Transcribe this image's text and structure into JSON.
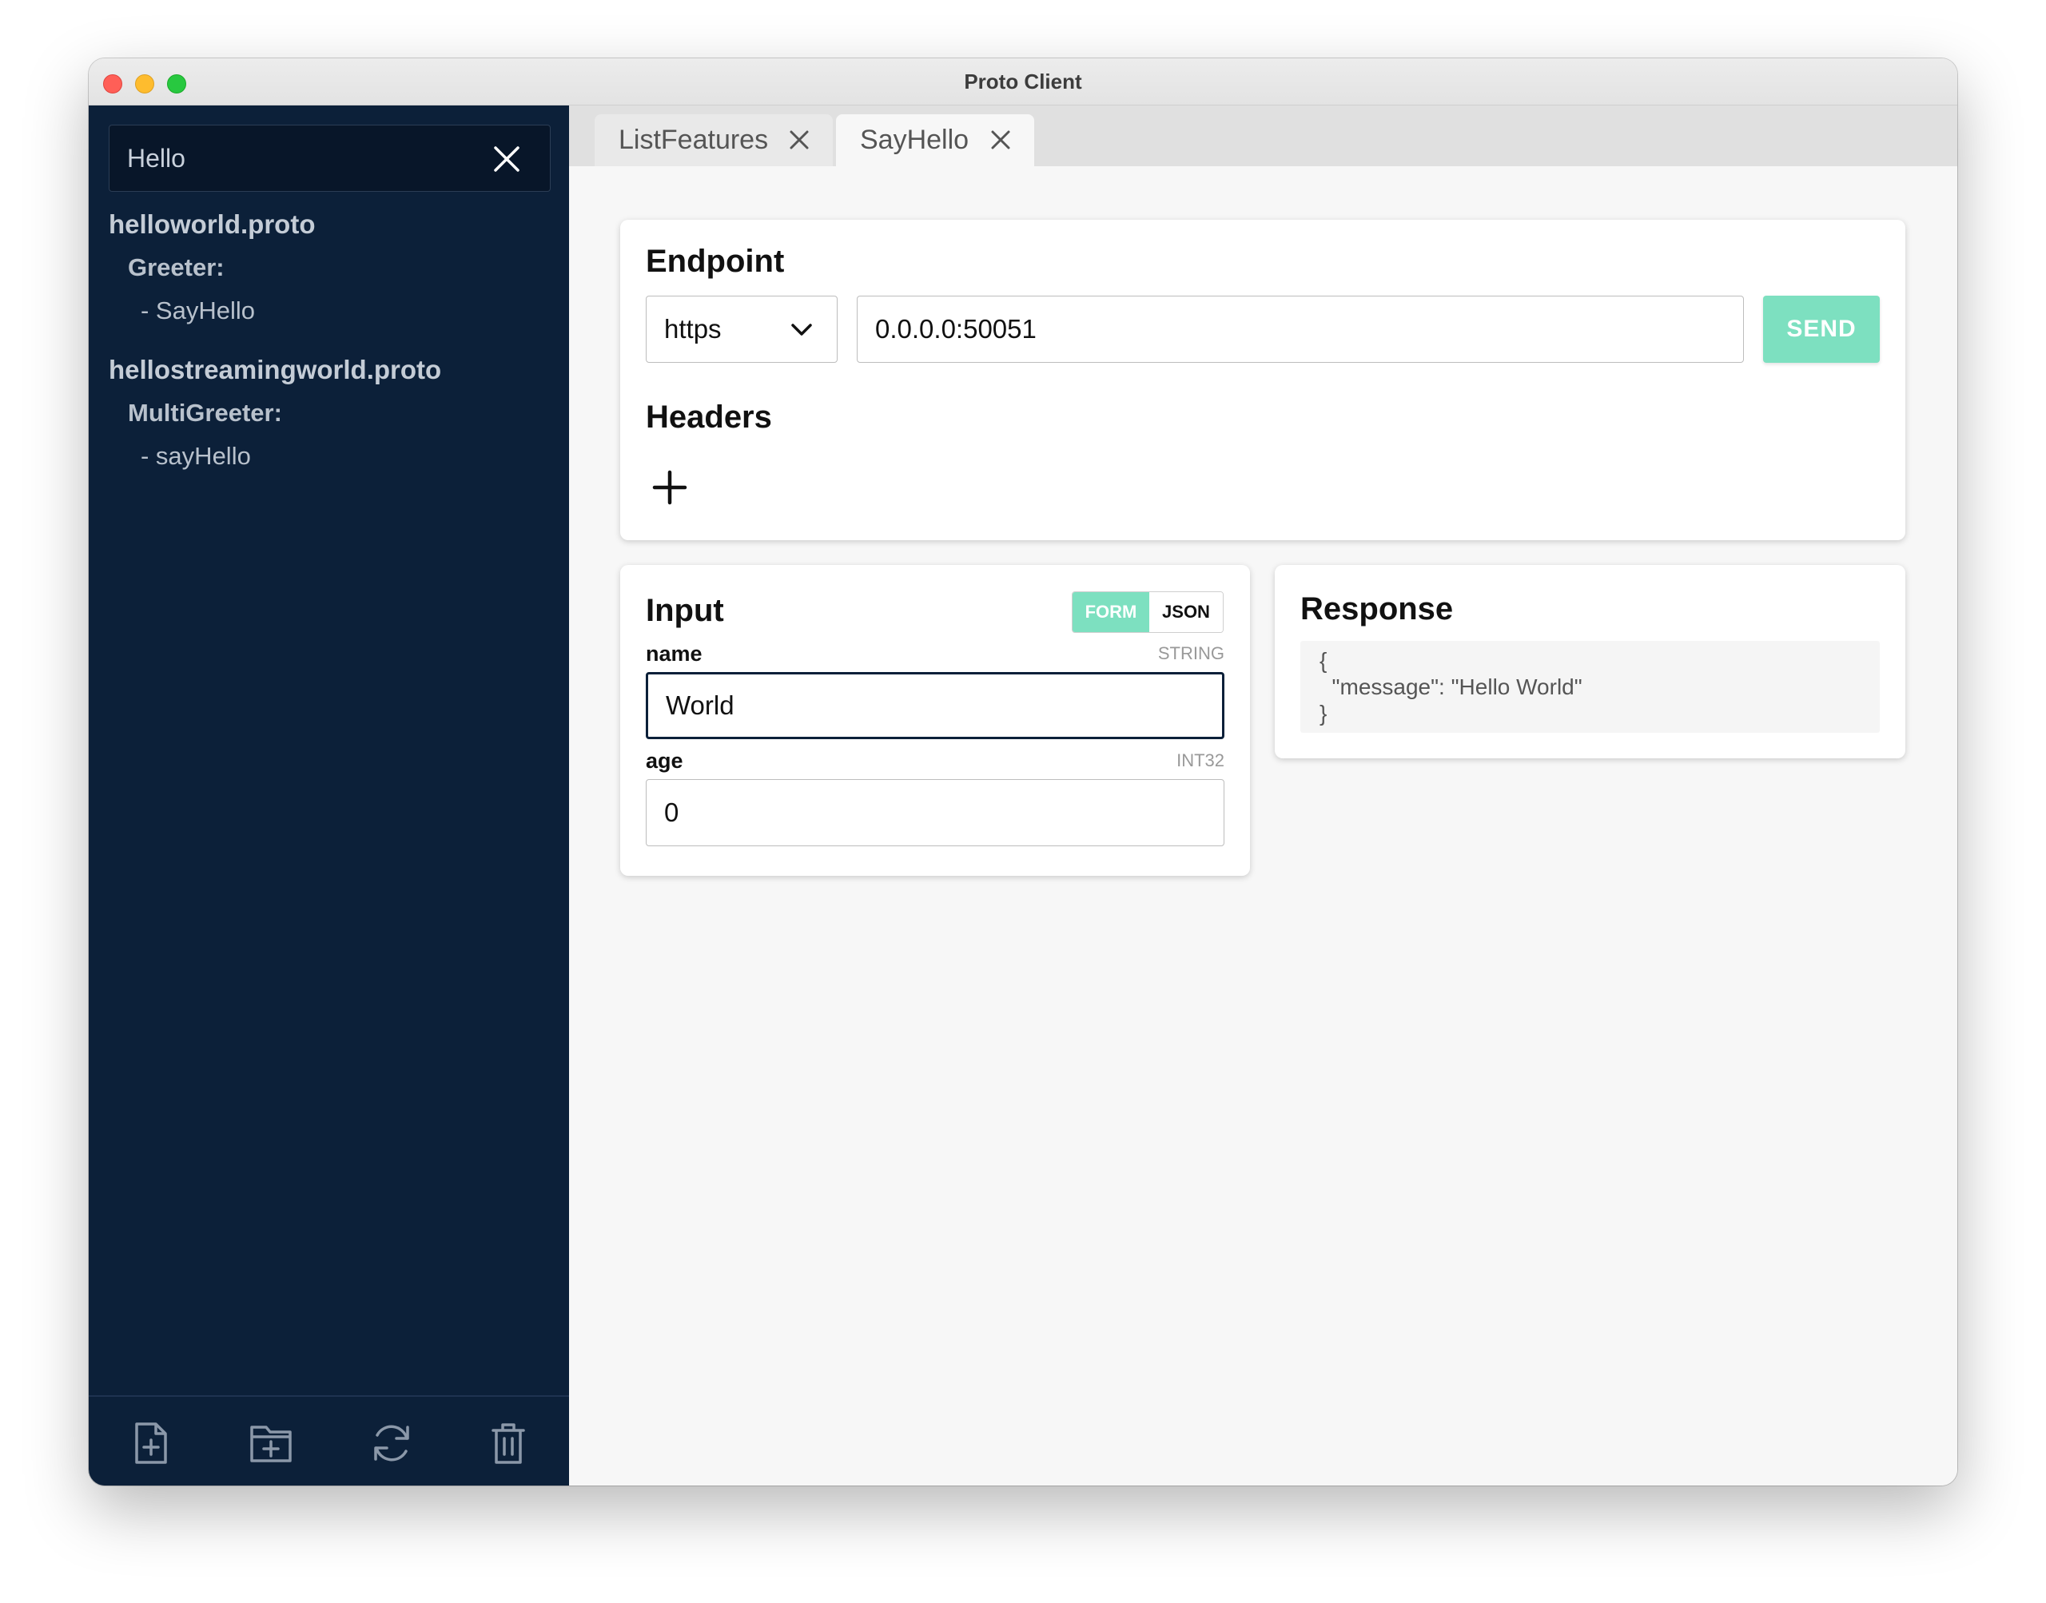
{
  "window": {
    "title": "Proto Client"
  },
  "sidebar": {
    "search": {
      "value": "Hello",
      "placeholder": ""
    },
    "tree": [
      {
        "file": "helloworld.proto",
        "service": "Greeter:",
        "method": "- SayHello"
      },
      {
        "file": "hellostreamingworld.proto",
        "service": "MultiGreeter:",
        "method": "- sayHello"
      }
    ],
    "footer_actions": [
      "add-file-icon",
      "add-folder-icon",
      "refresh-icon",
      "trash-icon"
    ]
  },
  "tabs": [
    {
      "label": "ListFeatures",
      "active": false
    },
    {
      "label": "SayHello",
      "active": true
    }
  ],
  "endpoint": {
    "title": "Endpoint",
    "protocol": "https",
    "url": "0.0.0.0:50051",
    "send_label": "SEND",
    "headers_title": "Headers"
  },
  "input": {
    "title": "Input",
    "mode_form": "FORM",
    "mode_json": "JSON",
    "active_mode": "FORM",
    "fields": [
      {
        "name": "name",
        "type": "STRING",
        "value": "World"
      },
      {
        "name": "age",
        "type": "INT32",
        "value": "0"
      }
    ]
  },
  "response": {
    "title": "Response",
    "body": "{\n  \"message\": \"Hello World\"\n}"
  },
  "colors": {
    "sidebar_bg": "#0c2039",
    "accent": "#7de0c0"
  }
}
